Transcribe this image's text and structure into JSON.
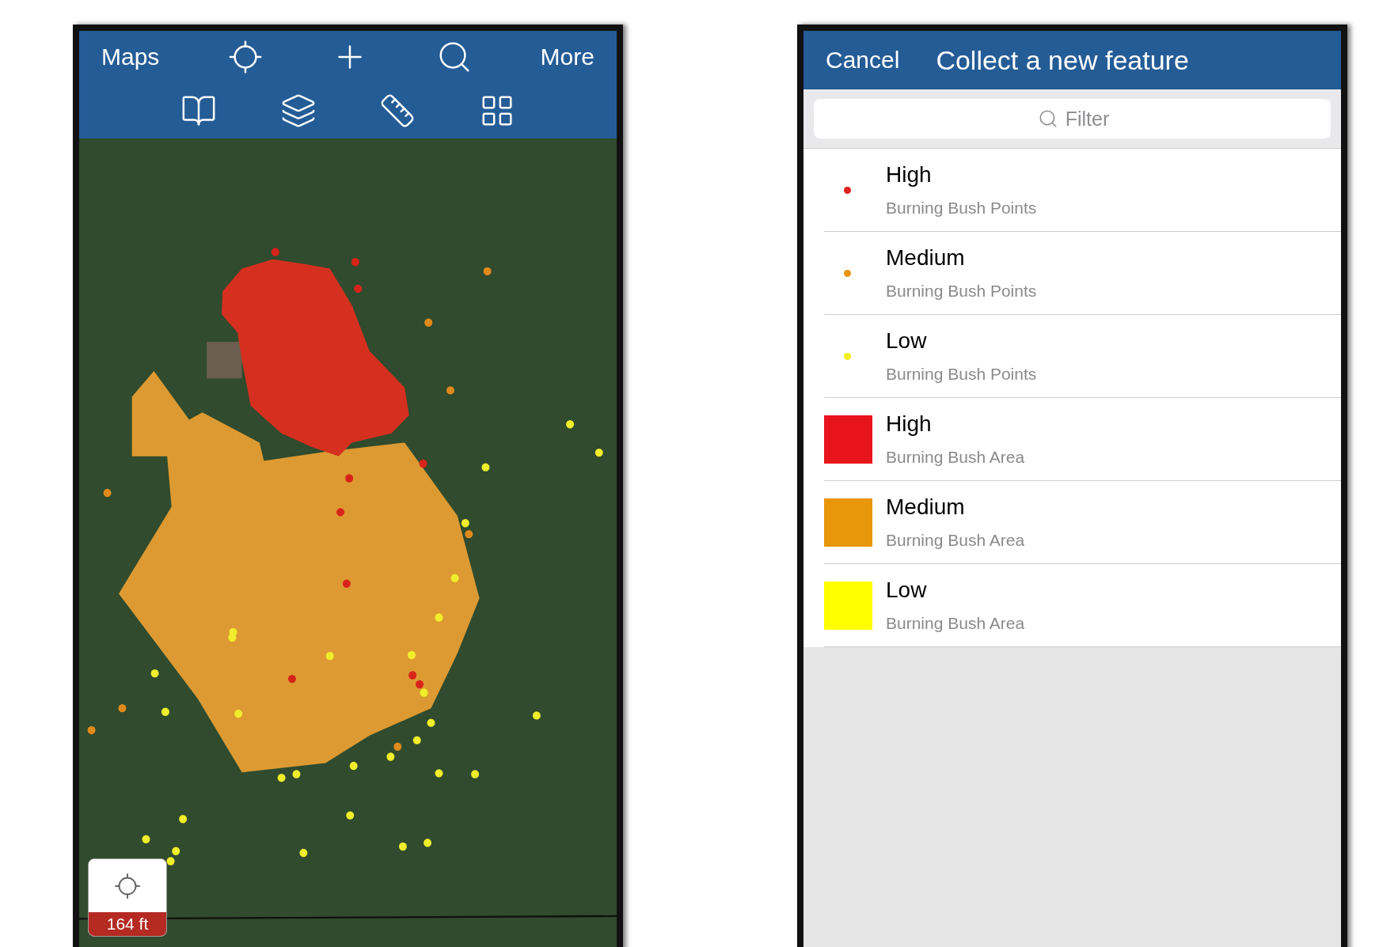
{
  "left_screen": {
    "toolbar": {
      "maps_button": "Maps",
      "more_button": "More"
    },
    "scale_widget": {
      "label": "164 ft"
    }
  },
  "right_screen": {
    "cancel_button": "Cancel",
    "title": "Collect a new feature",
    "filter": {
      "placeholder": "Filter"
    },
    "templates": [
      {
        "kind": "point",
        "name": "High",
        "layer": "Burning Bush Points",
        "color": "#e0201c"
      },
      {
        "kind": "point",
        "name": "Medium",
        "layer": "Burning Bush Points",
        "color": "#e8950f"
      },
      {
        "kind": "point",
        "name": "Low",
        "layer": "Burning Bush Points",
        "color": "#f2ee1a"
      },
      {
        "kind": "area",
        "name": "High",
        "layer": "Burning Bush Area",
        "color": "#e8141c"
      },
      {
        "kind": "area",
        "name": "Medium",
        "layer": "Burning Bush Area",
        "color": "#e8960a"
      },
      {
        "kind": "area",
        "name": "Low",
        "layer": "Burning Bush Area",
        "color": "#ffff00"
      }
    ]
  }
}
